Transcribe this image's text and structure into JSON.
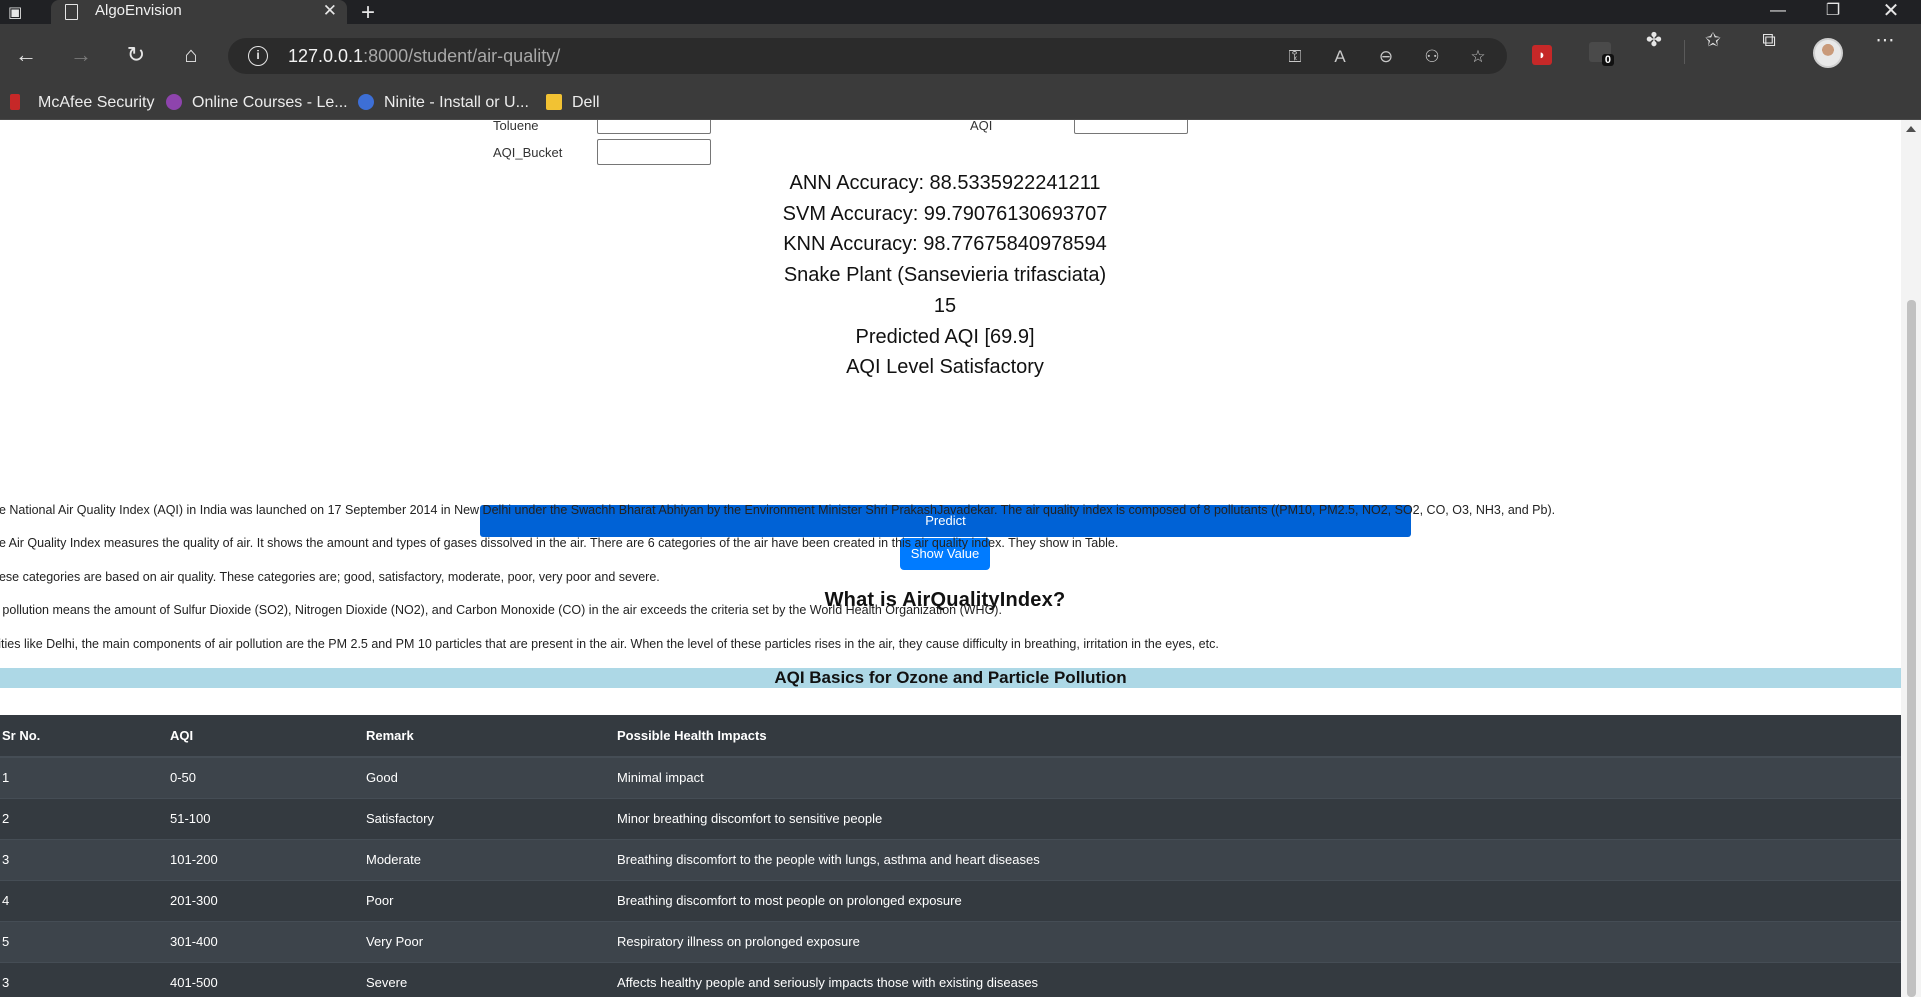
{
  "browser": {
    "tab_title": "AlgoEnvision",
    "url_host": "127.0.0.1",
    "url_path": ":8000/student/air-quality/",
    "bookmarks": [
      "McAfee Security",
      "Online Courses - Le...",
      "Ninite - Install or U...",
      "Dell"
    ],
    "extension_badge": "0"
  },
  "form": {
    "fields": [
      {
        "label": "Toluene",
        "value": ""
      },
      {
        "label": "AQI",
        "value": ""
      },
      {
        "label": "AQI_Bucket",
        "value": ""
      }
    ]
  },
  "results": {
    "ann": "ANN Accuracy: 88.5335922241211",
    "svm": "SVM Accuracy: 99.79076130693707",
    "knn": "KNN Accuracy: 98.77675840978594",
    "plant": "Snake Plant (Sansevieria trifasciata)",
    "count": "15",
    "predicted": "Predicted AQI [69.9]",
    "level": "AQI Level Satisfactory"
  },
  "buttons": {
    "predict": "Predict",
    "show_value": "Show Value"
  },
  "info": {
    "title": "What is AirQualityIndex?",
    "paragraphs": [
      "he National Air Quality Index (AQI) in India was launched on 17 September 2014 in New Delhi under the Swachh Bharat Abhiyan by the Environment Minister Shri PrakashJavadekar. The air quality index is composed of 8 pollutants ((PM10, PM2.5, NO2, SO2, CO, O3, NH3, and Pb).",
      "he Air Quality Index measures the quality of air. It shows the amount and types of gases dissolved in the air. There are 6 categories of the air have been created in this air quality index. They show in Table.",
      "hese categories are based on air quality. These categories are; good, satisfactory, moderate, poor, very poor and severe.",
      "ir pollution means the amount of Sulfur Dioxide (SO2), Nitrogen Dioxide (NO2), and Carbon Monoxide (CO) in the air exceeds the criteria set by the World Health Organization (WHO).",
      " cities like Delhi, the main components of air pollution are the PM 2.5 and PM 10 particles that are present in the air. When the level of these particles rises in the air, they cause difficulty in breathing, irritation in the eyes, etc."
    ]
  },
  "table": {
    "caption": "AQI Basics for Ozone and Particle Pollution",
    "headers": [
      "Sr No.",
      "AQI",
      "Remark",
      "Possible Health Impacts"
    ],
    "rows": [
      [
        "1",
        "0-50",
        "Good",
        "Minimal impact"
      ],
      [
        "2",
        "51-100",
        "Satisfactory",
        "Minor breathing discomfort to sensitive people"
      ],
      [
        "3",
        "101-200",
        "Moderate",
        "Breathing discomfort to the people with lungs, asthma and heart diseases"
      ],
      [
        "4",
        "201-300",
        "Poor",
        "Breathing discomfort to most people on prolonged exposure"
      ],
      [
        "5",
        "301-400",
        "Very Poor",
        "Respiratory illness on prolonged exposure"
      ],
      [
        "3",
        "401-500",
        "Severe",
        "Affects healthy people and seriously impacts those with existing diseases"
      ]
    ]
  }
}
